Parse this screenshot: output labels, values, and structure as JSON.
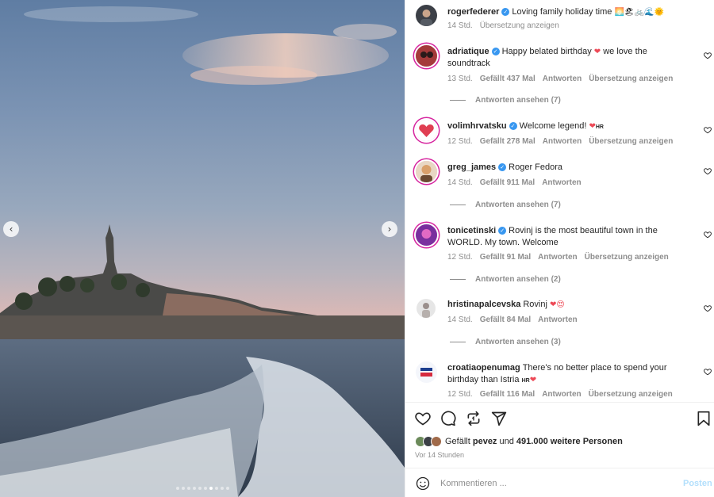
{
  "post": {
    "image_dots_count": 10,
    "image_dots_active": 6,
    "prev_glyph": "‹",
    "next_glyph": "›"
  },
  "caption": {
    "user": "rogerfederer",
    "text": "Loving family holiday time",
    "emoji": "🌅🏖🚲🌊🌞",
    "time": "14 Std.",
    "translate": "Übersetzung anzeigen",
    "avatar_color": "#3b3f46"
  },
  "comments": [
    {
      "user": "adriatique",
      "text": "Happy belated birthday",
      "emoji_mid": "❤",
      "text2": "we love the soundtrack",
      "time": "13 Std.",
      "likes": "Gefällt 437 Mal",
      "reply": "Antworten",
      "translate": "Übersetzung anzeigen",
      "view_replies": "Antworten ansehen (7)",
      "avatar_color": "#a43a3a"
    },
    {
      "user": "volimhrvatsku",
      "text": "Welcome legend!",
      "emoji": "❤",
      "flag": "HR",
      "time": "12 Std.",
      "likes": "Gefällt 278 Mal",
      "reply": "Antworten",
      "translate": "Übersetzung anzeigen",
      "avatar_color": "#e03e52"
    },
    {
      "user": "greg_james",
      "text": "Roger Fedora",
      "time": "14 Std.",
      "likes": "Gefällt 911 Mal",
      "reply": "Antworten",
      "view_replies": "Antworten ansehen (7)",
      "avatar_color": "#d9a06b"
    },
    {
      "user": "tonicetinski",
      "text": "Rovinj is the most beautiful town in the WORLD. My town. Welcome",
      "time": "12 Std.",
      "likes": "Gefällt 91 Mal",
      "reply": "Antworten",
      "translate": "Übersetzung anzeigen",
      "view_replies": "Antworten ansehen (2)",
      "avatar_color": "#7a2f9e"
    },
    {
      "user": "hristinapalcevska",
      "text": "Rovinj",
      "emoji": "❤😍",
      "time": "14 Std.",
      "likes": "Gefällt 84 Mal",
      "reply": "Antworten",
      "view_replies": "Antworten ansehen (3)",
      "avatar_color": "#c9c9c9"
    },
    {
      "user": "croatiaopenumag",
      "text": "There's no better place to spend your birthday than Istria",
      "flag": "HR",
      "emoji": "❤",
      "time": "12 Std.",
      "likes": "Gefällt 116 Mal",
      "reply": "Antworten",
      "translate": "Übersetzung anzeigen",
      "avatar_color": "#1d3f8f"
    }
  ],
  "likes": {
    "prefix": "Gefällt",
    "user": "pevez",
    "middle": "und",
    "count": "491.000 weitere Personen"
  },
  "time_ago": "Vor 14 Stunden",
  "composer": {
    "placeholder": "Kommentieren ...",
    "post_label": "Posten"
  },
  "colors": {
    "verified": "#3897f0",
    "heart": "#ed4956",
    "muted": "#8e8e8e",
    "post_disabled": "#b2dffc"
  }
}
